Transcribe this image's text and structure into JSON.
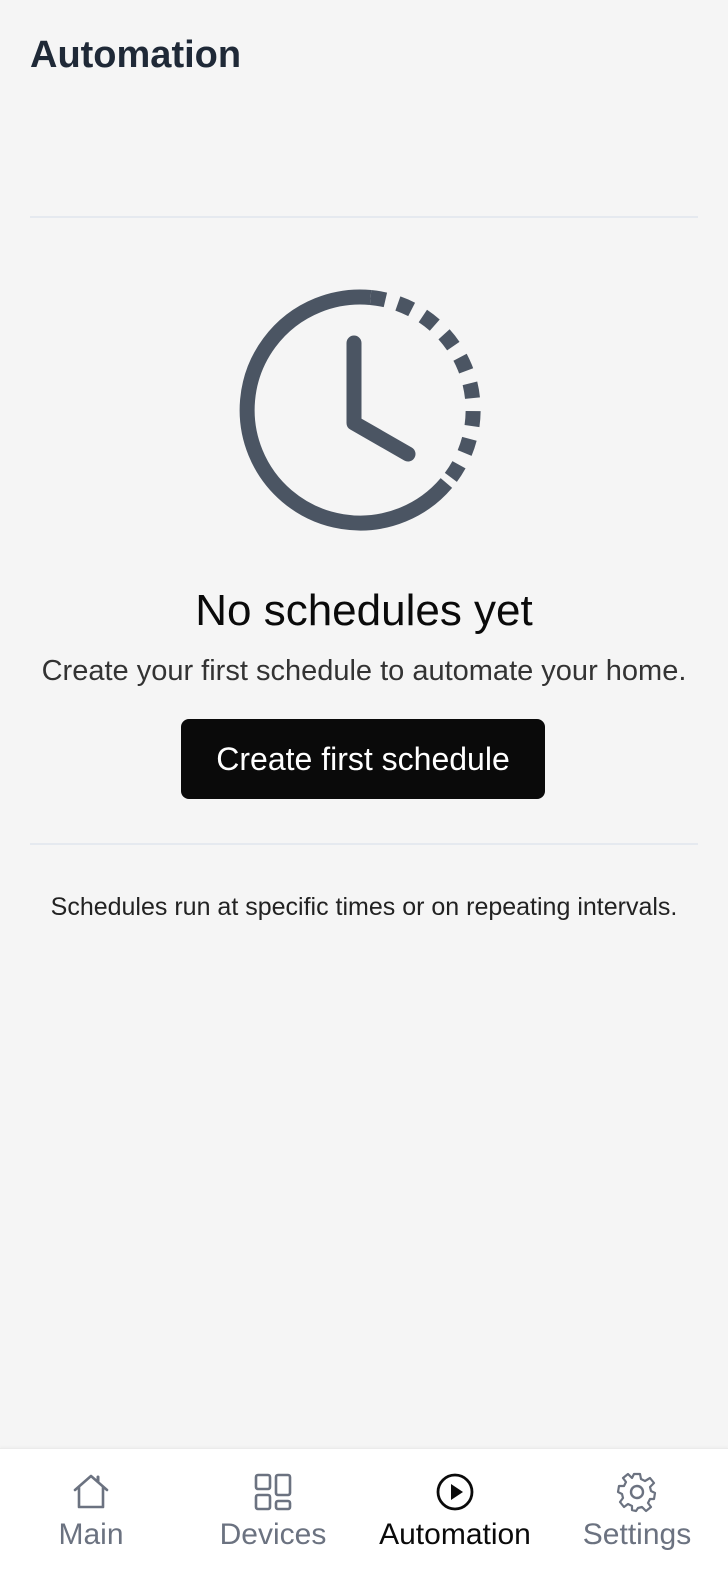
{
  "header": {
    "title": "Automation"
  },
  "empty_state": {
    "icon": "clock-icon",
    "icon_color": "#4b5563",
    "title": "No schedules yet",
    "description": "Create your first schedule to automate your home.",
    "button_label": "Create first schedule"
  },
  "info": {
    "text": "Schedules run at specific times or on repeating intervals."
  },
  "bottom_nav": {
    "active": "Automation",
    "active_color": "#0a0a0a",
    "inactive_color": "#6b7280",
    "items": [
      {
        "label": "Main",
        "icon": "home-icon"
      },
      {
        "label": "Devices",
        "icon": "grid-icon"
      },
      {
        "label": "Automation",
        "icon": "play-circle-icon"
      },
      {
        "label": "Settings",
        "icon": "gear-icon"
      }
    ]
  }
}
